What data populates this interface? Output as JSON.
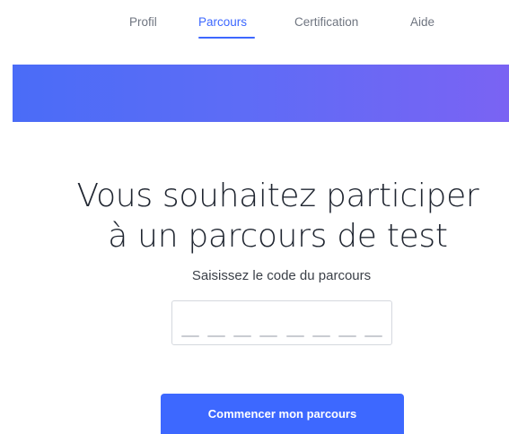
{
  "nav": {
    "items": [
      {
        "label": "Profil",
        "active": false
      },
      {
        "label": "Parcours",
        "active": true
      },
      {
        "label": "Certification",
        "active": false
      },
      {
        "label": "Aide",
        "active": false
      }
    ]
  },
  "main": {
    "title_line1": "Vous souhaitez participer",
    "title_line2": "à un parcours de test",
    "subtitle": "Saisissez le code du parcours",
    "code_input": {
      "value": "",
      "slots": 8
    },
    "start_button_label": "Commencer mon parcours"
  },
  "colors": {
    "accent": "#3d68ff",
    "banner_gradient_start": "#4a6cf7",
    "banner_gradient_end": "#7a63f3",
    "nav_text": "#6f7580",
    "title_text": "#1f2530"
  }
}
